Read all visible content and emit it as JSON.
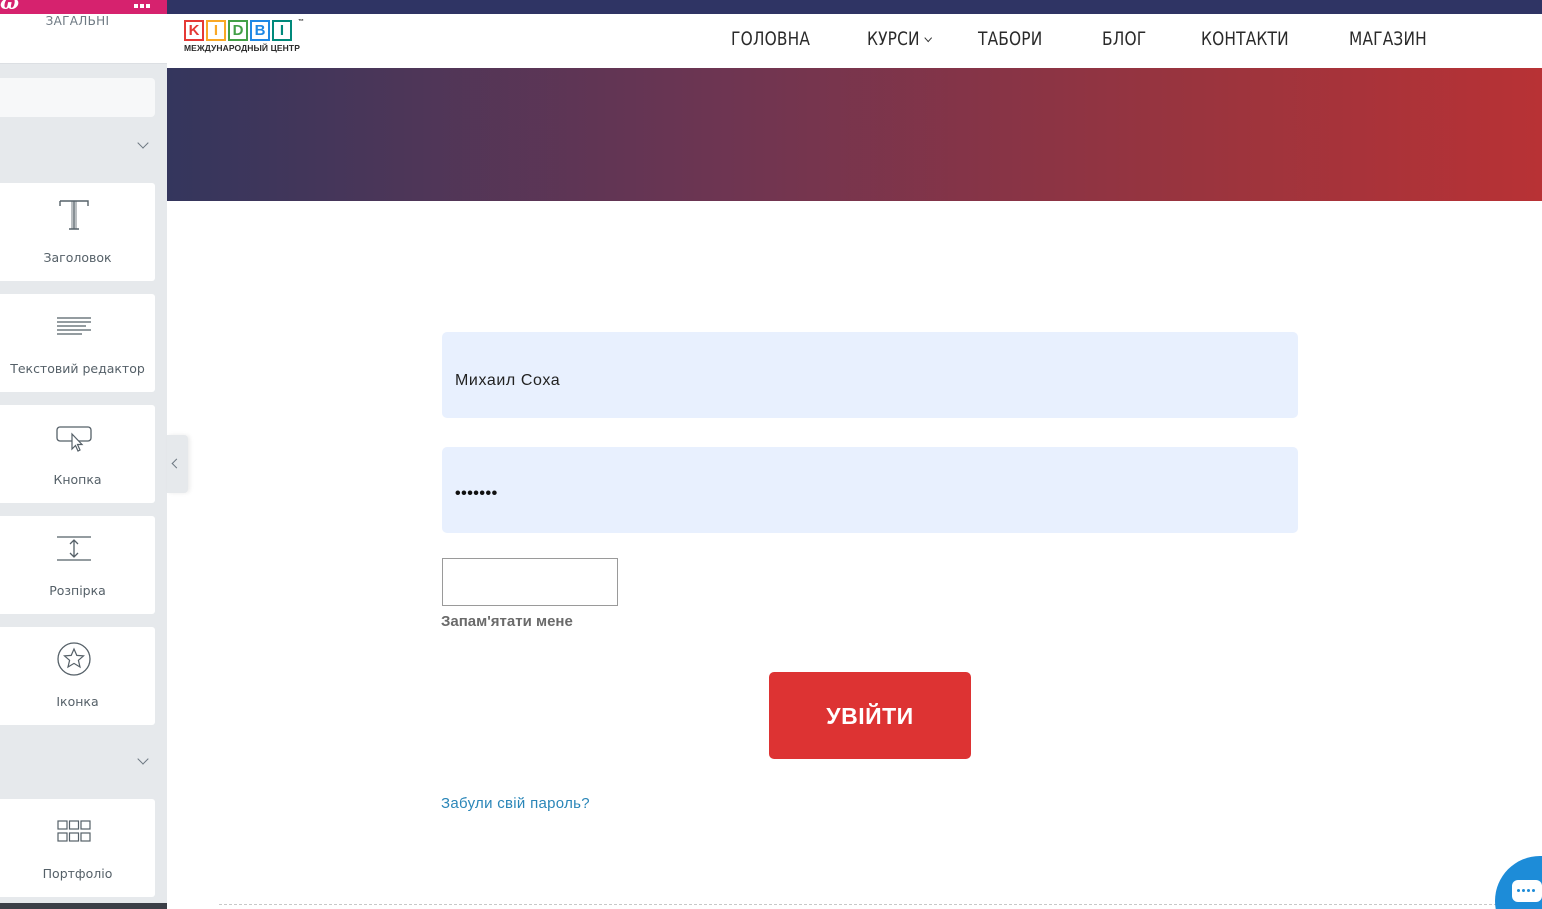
{
  "sidebar": {
    "tab_label": "ЗАГАЛЬНІ",
    "widgets": [
      {
        "label": "Заголовок",
        "icon": "heading-icon"
      },
      {
        "label": "Текстовий редактор",
        "icon": "text-editor-icon"
      },
      {
        "label": "Кнопка",
        "icon": "button-icon"
      },
      {
        "label": "Розпірка",
        "icon": "spacer-icon"
      },
      {
        "label": "Іконка",
        "icon": "star-icon"
      },
      {
        "label": "Портфоліо",
        "icon": "portfolio-grid-icon"
      }
    ]
  },
  "brand": {
    "letters": [
      "K",
      "I",
      "D",
      "B",
      "I"
    ],
    "letter_colors": [
      "#e53935",
      "#f9a825",
      "#43a047",
      "#1e88e5",
      "#00897b"
    ],
    "tm": "™",
    "subtitle": "МЕЖДУНАРОДНЫЙ ЦЕНТР"
  },
  "nav": {
    "home": "ГОЛОВНА",
    "courses": "КУРСИ",
    "camps": "ТАБОРИ",
    "blog": "БЛОГ",
    "contacts": "КОНТАКТИ",
    "shop": "МАГАЗИН"
  },
  "login": {
    "username_value": "Михаил Соха",
    "password_mask": "•••••••",
    "remember_label": "Запам'ятати мене",
    "submit_label": "УВІЙТИ",
    "forgot_link": "Забули свій пароль?"
  },
  "colors": {
    "editor_accent": "#d6226e",
    "submit_button": "#dd3333",
    "link": "#2a86b8",
    "topbar": "#2f3464"
  }
}
